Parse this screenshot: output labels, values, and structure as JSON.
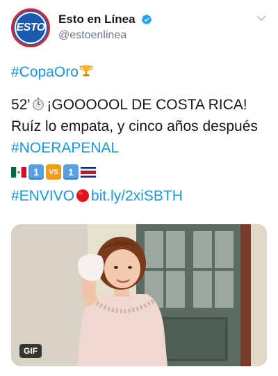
{
  "account": {
    "avatar_text": "ESTO",
    "display_name": "Esto en Línea",
    "handle": "@estoenlinea"
  },
  "tweet": {
    "hashtag_copa": "#CopaOro",
    "line_52_prefix": "52'",
    "line_52_text": "¡GOOOOOL DE COSTA RICA!",
    "line_ruiz": "Ruíz lo empata, y cinco años después",
    "hashtag_noerapenal": "#NOERAPENAL",
    "score_home": "1",
    "score_vs": "VS",
    "score_away": "1",
    "hashtag_envivo": "#ENVIVO",
    "link": "bit.ly/2xiSBTH"
  },
  "media": {
    "badge": "GIF"
  },
  "colors": {
    "link": "#1b95e0",
    "verified": "#1da1f2",
    "text": "#14171a",
    "muted": "#657786"
  },
  "icons": [
    "trophy-icon",
    "stopwatch-icon",
    "mexico-flag-icon",
    "costa-rica-flag-icon",
    "red-circle-icon",
    "verified-icon",
    "chevron-down-icon"
  ]
}
